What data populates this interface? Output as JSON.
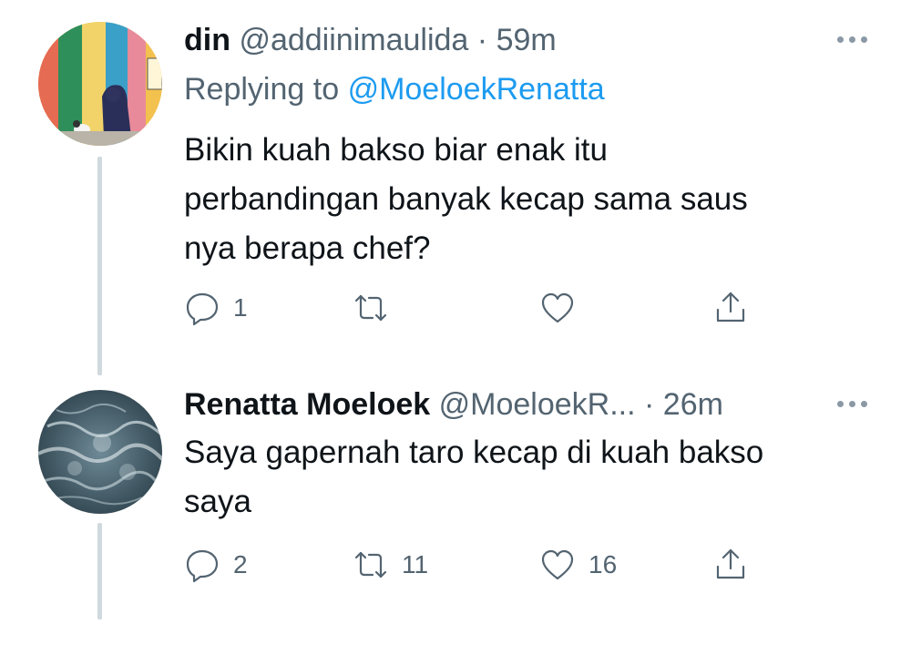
{
  "tweets": [
    {
      "name": "din",
      "handle": "@addiinimaulida",
      "separator": "·",
      "time": "59m",
      "replying_prefix": "Replying to",
      "replying_handle": "@MoeloekRenatta",
      "text_lines": [
        "Bikin kuah bakso biar enak itu",
        "perbandingan banyak kecap sama saus",
        "nya berapa chef?"
      ],
      "counts": {
        "reply": "1",
        "retweet": "",
        "like": ""
      },
      "icons": [
        "reply-icon",
        "retweet-icon",
        "like-icon",
        "share-icon",
        "more-icon"
      ]
    },
    {
      "name": "Renatta Moeloek",
      "handle": "@MoeloekR...",
      "separator": "·",
      "time": "26m",
      "text_lines": [
        "Saya gapernah taro kecap di kuah bakso",
        "saya"
      ],
      "counts": {
        "reply": "2",
        "retweet": "11",
        "like": "16"
      },
      "icons": [
        "reply-icon",
        "retweet-icon",
        "like-icon",
        "share-icon",
        "more-icon"
      ]
    }
  ],
  "colors": {
    "text": "#0f1419",
    "muted": "#536471",
    "link": "#1d9bf0",
    "thread_line": "#cfd9de"
  }
}
